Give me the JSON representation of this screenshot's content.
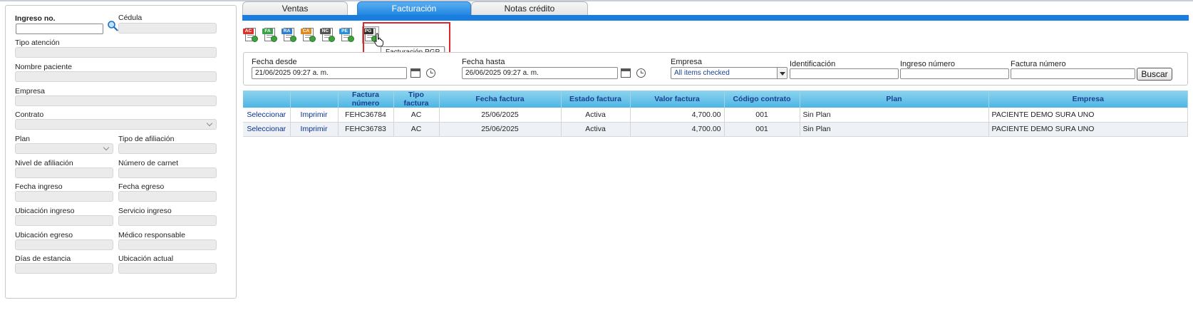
{
  "left_panel": {
    "ingreso_no_label": "Ingreso no.",
    "cedula_label": "Cédula",
    "tipo_atencion_label": "Tipo atención",
    "nombre_paciente_label": "Nombre paciente",
    "empresa_label": "Empresa",
    "contrato_label": "Contrato",
    "plan_label": "Plan",
    "tipo_afiliacion_label": "Tipo de afiliación",
    "nivel_afiliacion_label": "Nivel de afiliación",
    "numero_carnet_label": "Número de carnet",
    "fecha_ingreso_label": "Fecha ingreso",
    "fecha_egreso_label": "Fecha egreso",
    "ubicacion_ingreso_label": "Ubicación ingreso",
    "servicio_ingreso_label": "Servicio ingreso",
    "ubicacion_egreso_label": "Ubicación egreso",
    "medico_responsable_label": "Médico responsable",
    "dias_estancia_label": "Días de estancia",
    "ubicacion_actual_label": "Ubicación actual"
  },
  "tabs": [
    {
      "label": "Ventas"
    },
    {
      "label": "Facturación"
    },
    {
      "label": "Notas crédito"
    }
  ],
  "toolbar": {
    "icons": [
      {
        "tag": "AC",
        "color": "#d8322a"
      },
      {
        "tag": "FA",
        "color": "#3aa34a"
      },
      {
        "tag": "RA",
        "color": "#2f7fd0"
      },
      {
        "tag": "CA",
        "color": "#e08a1e"
      },
      {
        "tag": "NC",
        "color": "#555555"
      },
      {
        "tag": "PE",
        "color": "#2a8fd6"
      },
      {
        "tag": "PG",
        "color": "#333333"
      }
    ],
    "tooltip": "Facturación PGP"
  },
  "filters": {
    "fecha_desde_label": "Fecha desde",
    "fecha_desde_value": "21/06/2025 09:27 a. m.",
    "fecha_hasta_label": "Fecha hasta",
    "fecha_hasta_value": "26/06/2025 09:27 a. m.",
    "empresa_label": "Empresa",
    "empresa_value": "All items checked",
    "identificacion_label": "Identificación",
    "ingreso_numero_label": "Ingreso número",
    "factura_numero_label": "Factura número",
    "buscar_label": "Buscar"
  },
  "table": {
    "headers": [
      "",
      "",
      "Factura número",
      "Tipo factura",
      "Fecha factura",
      "Estado factura",
      "Valor factura",
      "Código contrato",
      "Plan",
      "Empresa"
    ],
    "rows": [
      {
        "select": "Seleccionar",
        "print": "Imprimir",
        "factura": "FEHC36784",
        "tipo": "AC",
        "fecha": "25/06/2025",
        "estado": "Activa",
        "valor": "4,700.00",
        "codigo": "001",
        "plan": "Sin Plan",
        "empresa": "PACIENTE DEMO SURA UNO"
      },
      {
        "select": "Seleccionar",
        "print": "Imprimir",
        "factura": "FEHC36783",
        "tipo": "AC",
        "fecha": "25/06/2025",
        "estado": "Activa",
        "valor": "4,700.00",
        "codigo": "001",
        "plan": "Sin Plan",
        "empresa": "PACIENTE DEMO SURA UNO"
      }
    ]
  }
}
